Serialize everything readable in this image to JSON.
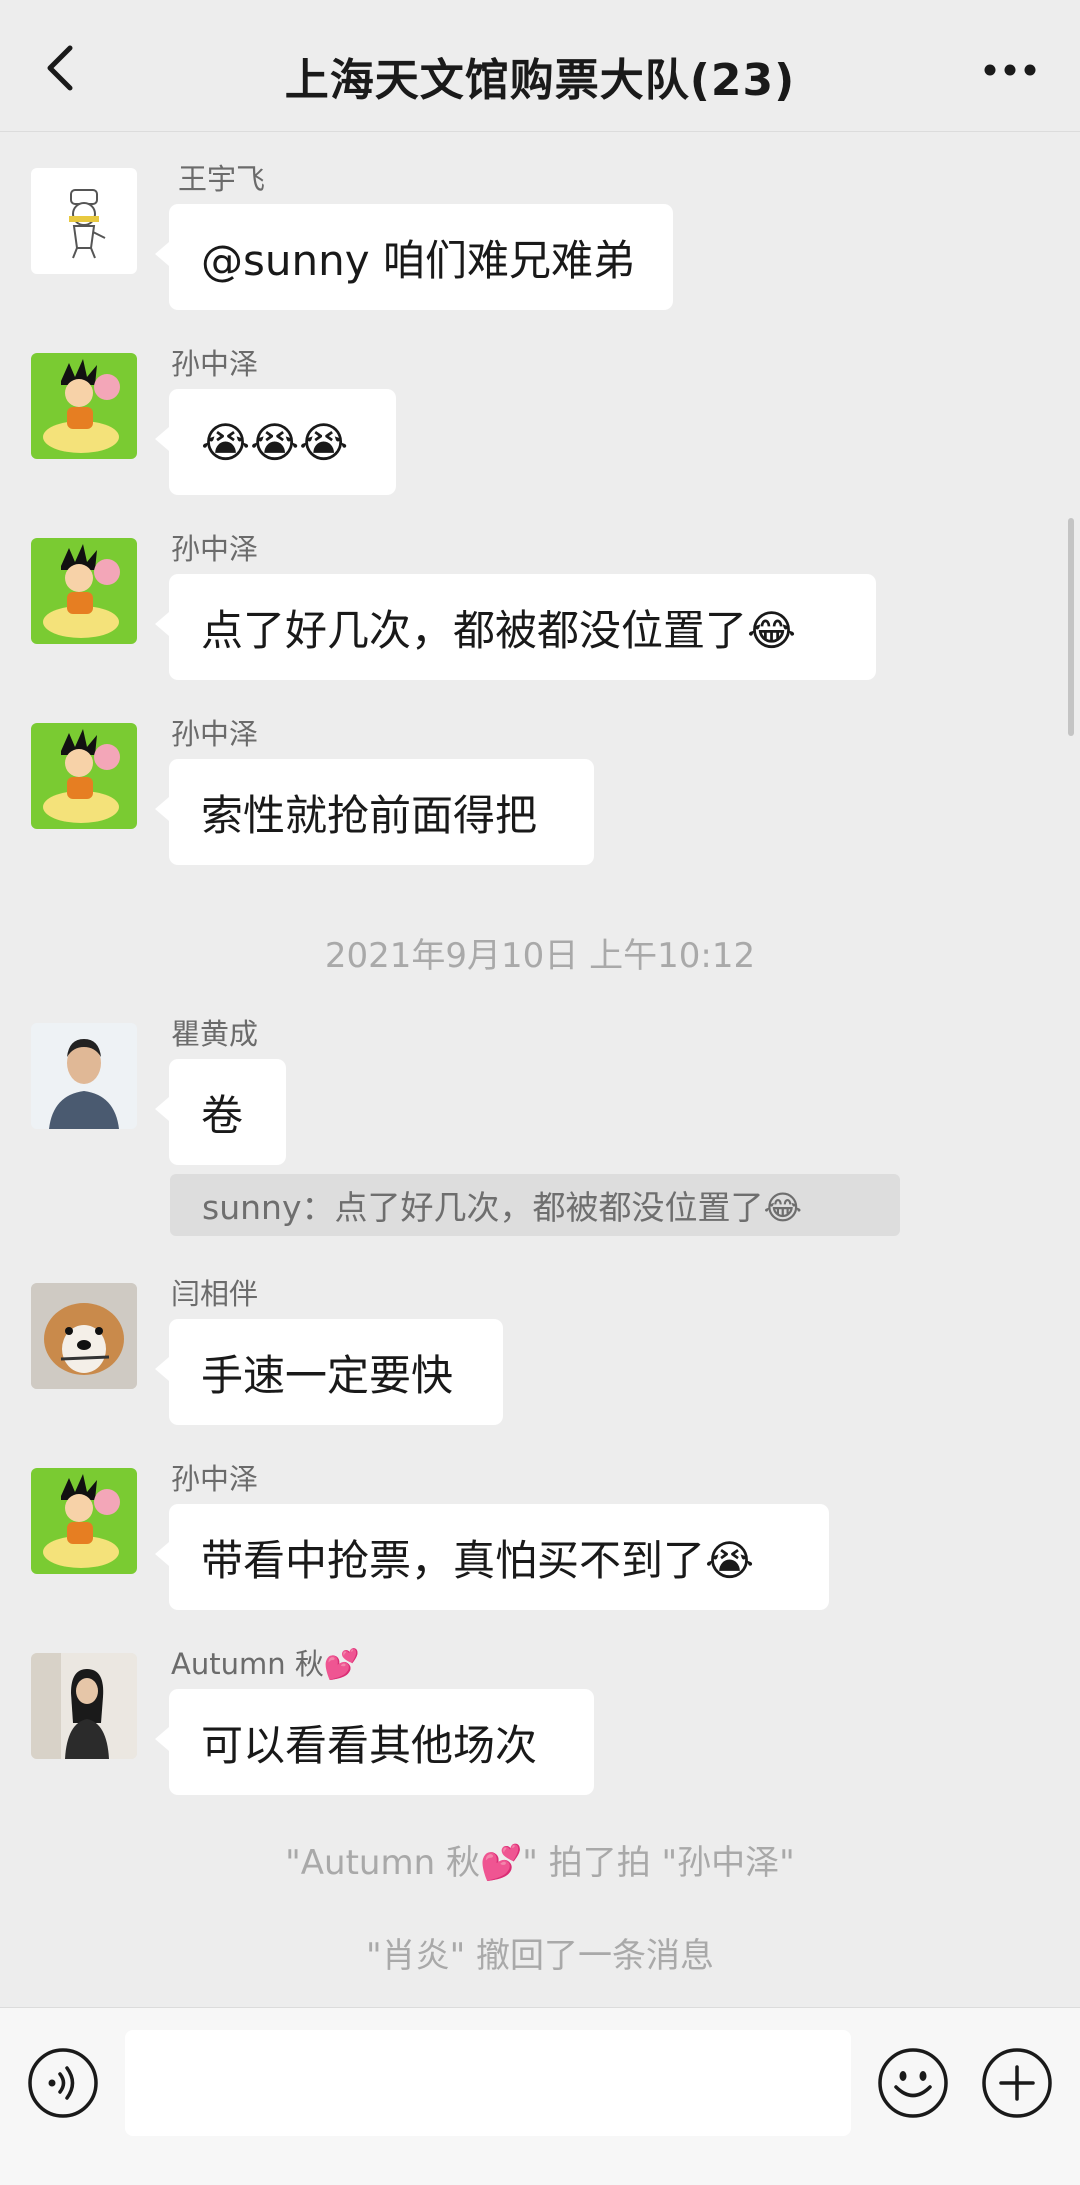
{
  "header": {
    "title": "上海天文馆购票大队(23)",
    "back_icon": "chevron-left-icon",
    "more_icon": "more-dots-icon"
  },
  "messages": [
    {
      "sender": "王宇飞",
      "text": "@sunny 咱们难兄难弟",
      "avatar": "chef-avatar"
    },
    {
      "sender": "孙中泽",
      "text": "😭😭😭",
      "avatar": "goku-avatar"
    },
    {
      "sender": "孙中泽",
      "text": "点了好几次，都被都没位置了😂",
      "avatar": "goku-avatar"
    },
    {
      "sender": "孙中泽",
      "text": "索性就抢前面得把",
      "avatar": "goku-avatar"
    },
    {
      "sender": "瞿黄成",
      "text": "卷",
      "avatar": "man-photo-avatar"
    },
    {
      "sender": "闫相伴",
      "text": "手速一定要快",
      "avatar": "dog-photo-avatar"
    },
    {
      "sender": "孙中泽",
      "text": "带看中抢票，真怕买不到了😭",
      "avatar": "goku-avatar"
    },
    {
      "sender": "Autumn 秋💕",
      "text": "可以看看其他场次",
      "avatar": "woman-photo-avatar"
    }
  ],
  "timestamp": "2021年9月10日 上午10:12",
  "quote": "sunny：点了好几次，都被都没位置了😂",
  "system_notes": {
    "pat": "\"Autumn 秋💕\" 拍了拍 \"孙中泽\"",
    "recall": "\"肖炎\" 撤回了一条消息"
  },
  "input": {
    "value": "",
    "placeholder": ""
  },
  "colors": {
    "background": "#EDEDED",
    "bubble": "#FFFFFF",
    "quote_bg": "#DDDDDD",
    "meta_text": "#A9A9A9"
  }
}
